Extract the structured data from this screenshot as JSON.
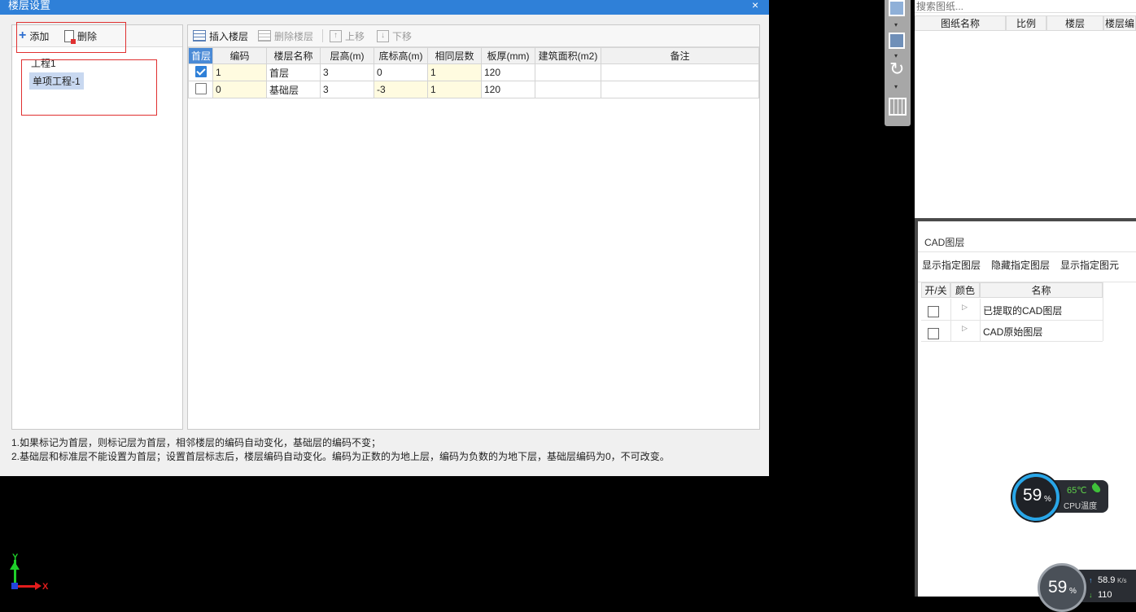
{
  "dialog": {
    "title": "楼层设置",
    "close_glyph": "×",
    "left_toolbar": {
      "add": "添加",
      "delete": "删除"
    },
    "tree": {
      "root": "工程1",
      "child": "单项工程-1"
    },
    "right_toolbar": {
      "insert": "插入楼层",
      "delete_floor": "删除楼层",
      "up": "上移",
      "down": "下移"
    },
    "table": {
      "columns": [
        "首层",
        "编码",
        "楼层名称",
        "层高(m)",
        "底标高(m)",
        "相同层数",
        "板厚(mm)",
        "建筑面积(m2)",
        "备注"
      ],
      "rows": [
        {
          "first": true,
          "code": "1",
          "name": "首层",
          "height": "3",
          "bottom": "0",
          "same": "1",
          "thick": "120",
          "area": "",
          "note": ""
        },
        {
          "first": false,
          "code": "0",
          "name": "基础层",
          "height": "3",
          "bottom": "-3",
          "same": "1",
          "thick": "120",
          "area": "",
          "note": ""
        }
      ]
    },
    "notes": [
      "1.如果标记为首层，则标记层为首层，相邻楼层的编码自动变化，基础层的编码不变；",
      "2.基础层和标准层不能设置为首层；设置首层标志后，楼层编码自动变化。编码为正数的为地上层，编码为负数的为地下层，基础层编码为0，不可改变。"
    ]
  },
  "drawings": {
    "search_placeholder": "搜索图纸...",
    "columns": [
      "图纸名称",
      "比例",
      "楼层",
      "楼层编"
    ]
  },
  "cad_layers": {
    "title": "CAD图层",
    "actions": [
      "显示指定图层",
      "隐藏指定图层",
      "显示指定图元"
    ],
    "columns": [
      "开/关",
      "颜色",
      "名称"
    ],
    "rows": [
      {
        "checked": false,
        "name": "已提取的CAD图层"
      },
      {
        "checked": false,
        "name": "CAD原始图层"
      }
    ]
  },
  "cpu_widget": {
    "percent": "59",
    "percent_sign": "%",
    "temp": "65℃",
    "label": "CPU温度"
  },
  "net_widget": {
    "percent": "59",
    "percent_sign": "%",
    "up": "58.9",
    "up_unit": "K/s",
    "down": "110"
  },
  "axes": {
    "y": "Y",
    "x": "X"
  },
  "colors": {
    "title_bar": "#2f80d8",
    "highlight": "#c8d8f0",
    "yellow_cell": "#fffbe0",
    "gauge_ring": "#29a6e8"
  }
}
